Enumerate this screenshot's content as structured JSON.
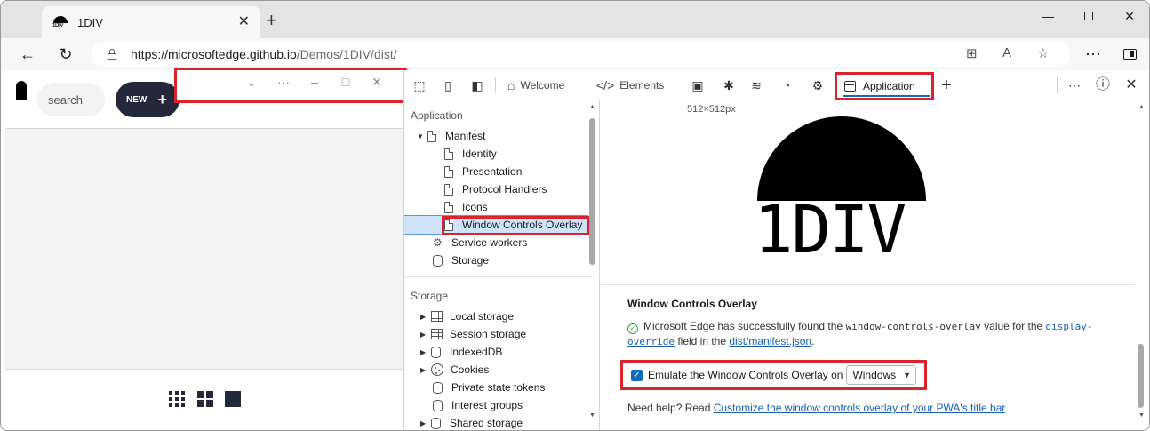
{
  "browser": {
    "tab_title": "1DIV",
    "tab_favicon_text": "1DIV",
    "url_host": "https://microsoftedge.github.io",
    "url_path": "/Demos/1DIV/dist/"
  },
  "app": {
    "search_placeholder": "search",
    "new_button_label": "NEW",
    "new_button_icon": "+"
  },
  "devtools": {
    "tabs": [
      {
        "label": "Welcome",
        "icon": "home-icon"
      },
      {
        "label": "Elements",
        "icon": "code-icon"
      },
      {
        "label": "Application",
        "icon": "application-icon"
      }
    ],
    "sidebar": {
      "application_section": "Application",
      "manifest_label": "Manifest",
      "manifest_children": [
        "Identity",
        "Presentation",
        "Protocol Handlers",
        "Icons",
        "Window Controls Overlay"
      ],
      "service_workers": "Service workers",
      "storage_item": "Storage",
      "storage_section": "Storage",
      "storage_items": [
        "Local storage",
        "Session storage",
        "IndexedDB",
        "Cookies",
        "Private state tokens",
        "Interest groups",
        "Shared storage"
      ]
    },
    "main": {
      "image_size": "512×512px",
      "logo_text": "1DIV",
      "wco_heading": "Window Controls Overlay",
      "msg_prefix": "Microsoft Edge has successfully found the",
      "msg_code": "window-controls-overlay",
      "msg_middle": "value for the",
      "msg_link_display": "display-override",
      "msg_field_in": "field in the",
      "msg_link_manifest": "dist/manifest.json",
      "msg_end": ".",
      "emulate_label": "Emulate the Window Controls Overlay on",
      "emulate_checked": true,
      "os_select_value": "Windows",
      "help_prefix": "Need help? Read",
      "help_link": "Customize the window controls overlay of your PWA's title bar",
      "help_end": "."
    }
  },
  "colors": {
    "highlight_red": "#d9232d",
    "accent_blue": "#0f6cbd",
    "selection_bg": "#cfe4fa",
    "app_button_dark": "#25283a"
  }
}
